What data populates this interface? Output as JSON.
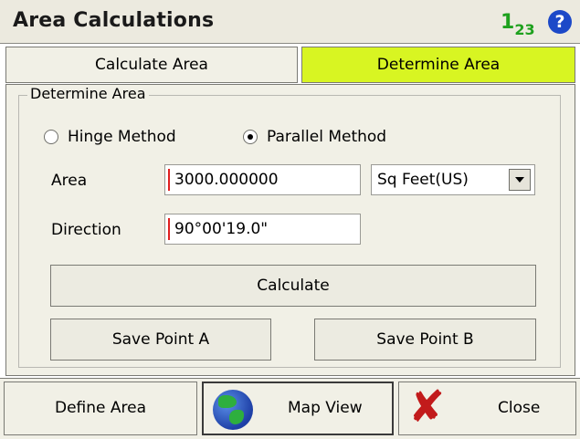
{
  "app": {
    "title": "Area Calculations",
    "digits_glyph": "1",
    "digits_sub": "2",
    "digits_tail": "3",
    "help_glyph": "?"
  },
  "tabs": [
    {
      "label": "Calculate Area",
      "active": false
    },
    {
      "label": "Determine Area",
      "active": true
    }
  ],
  "group": {
    "title": "Determine Area",
    "radios": [
      {
        "label": "Hinge Method",
        "checked": false
      },
      {
        "label": "Parallel Method",
        "checked": true
      }
    ],
    "area_label": "Area",
    "area_value": "3000.000000",
    "unit_selected": "Sq Feet(US)",
    "direction_label": "Direction",
    "direction_value": "90°00'19.0\"",
    "calculate_label": "Calculate",
    "save_a_label": "Save Point A",
    "save_b_label": "Save Point B"
  },
  "bottom": {
    "define_label": "Define Area",
    "map_label": "Map View",
    "close_label": "Close"
  },
  "colors": {
    "active_tab": "#d8f522",
    "panel": "#f1f0e6",
    "accent_red": "#e02020"
  }
}
